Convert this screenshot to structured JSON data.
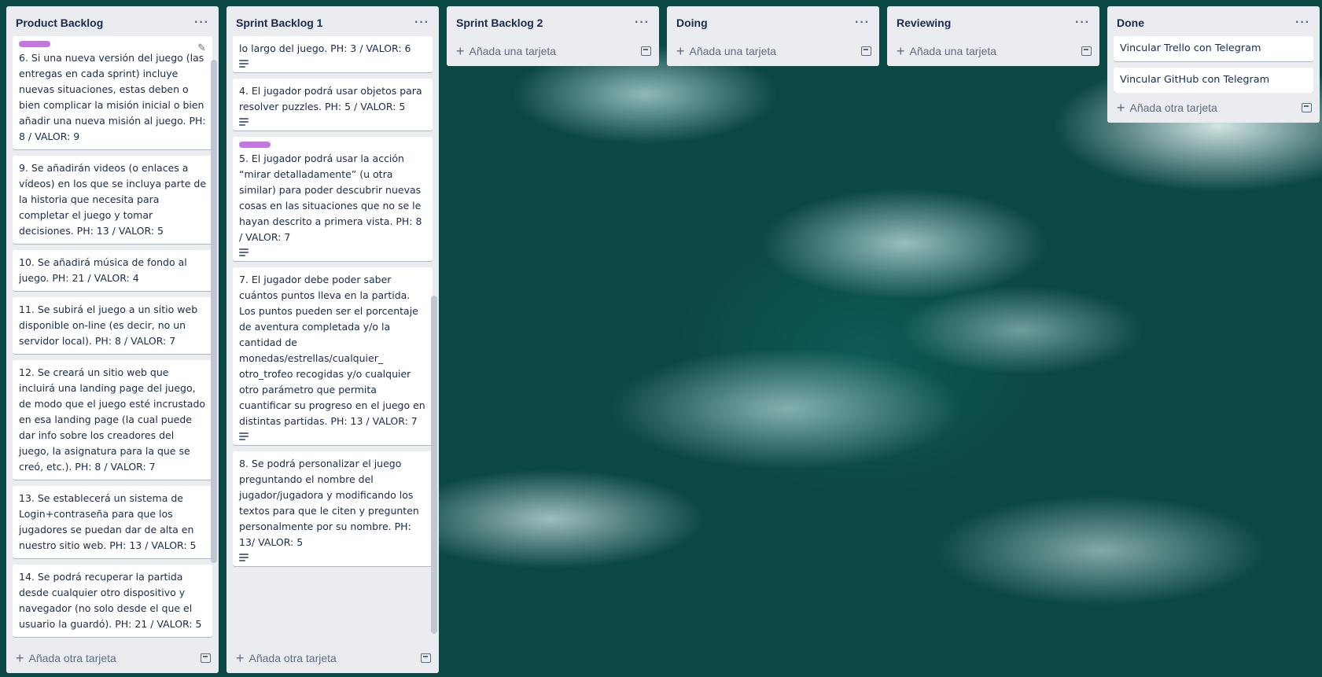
{
  "lists": [
    {
      "title": "Product Backlog",
      "menu": "···",
      "add_label": "Añada otra tarjeta",
      "cards": [
        {
          "text": "6. Si una nueva versión del juego (las entregas en cada sprint) incluye nuevas situaciones, estas deben o bien complicar la misión inicial o bien añadir una nueva misión al juego. PH: 8 / VALOR: 9",
          "label": true,
          "desc": false
        },
        {
          "text": "9. Se añadirán videos (o enlaces a vídeos) en los que se incluya parte de la historia que necesita para completar el juego y tomar decisiones. PH: 13 / VALOR: 5"
        },
        {
          "text": "10. Se añadirá música de fondo al juego. PH: 21 / VALOR: 4"
        },
        {
          "text": "11. Se subirá el juego a un sitio web disponible on-line (es decir, no un servidor local). PH: 8 / VALOR: 7"
        },
        {
          "text": "12. Se creará un sitio web que incluirá una landing page del juego, de modo que el juego esté incrustado en esa landing page (la cual puede dar info sobre los creadores del juego, la asignatura para la que se creó, etc.). PH: 8 / VALOR: 7"
        },
        {
          "text": "13. Se establecerá un sistema de Login+contraseña para que los jugadores se puedan dar de alta en nuestro sitio web. PH: 13 / VALOR: 5"
        },
        {
          "text": "14. Se podrá recuperar la partida desde cualquier otro dispositivo y navegador (no solo desde el que el usuario la guardó). PH: 21 / VALOR: 5"
        }
      ]
    },
    {
      "title": "Sprint Backlog 1",
      "menu": "···",
      "add_label": "Añada otra tarjeta",
      "cards": [
        {
          "text": "lo largo del juego. PH: 3 / VALOR: 6"
        },
        {
          "text": "4. El jugador podrá usar objetos para resolver puzzles. PH: 5 / VALOR: 5"
        },
        {
          "text": "5. El jugador podrá usar la acción “mirar detalladamente” (u otra similar) para poder descubrir nuevas cosas en las situaciones que no se le hayan descrito a primera vista. PH: 8 / VALOR: 7"
        },
        {
          "text": "7. El jugador debe poder saber cuántos puntos lleva en la partida. Los puntos pueden ser el porcentaje de aventura completada y/o la cantidad de monedas/estrellas/cualquier_ otro_trofeo recogidas y/o cualquier otro parámetro que permita cuantificar su progreso en el juego en distintas partidas. PH: 13 / VALOR: 7"
        },
        {
          "text": "8. Se podrá personalizar el juego preguntando el nombre del jugador/jugadora y modificando los textos para que le citen y pregunten personalmente por su nombre. PH: 13/ VALOR: 5"
        }
      ]
    },
    {
      "title": "Sprint Backlog 2",
      "menu": "···",
      "add_label": "Añada una tarjeta"
    },
    {
      "title": "Doing",
      "menu": "···",
      "add_label": "Añada una tarjeta"
    },
    {
      "title": "Reviewing",
      "menu": "···",
      "add_label": "Añada una tarjeta"
    },
    {
      "title": "Done",
      "menu": "···",
      "add_label": "Añada otra tarjeta",
      "cards": [
        {
          "text": "Vincular Trello con Telegram"
        },
        {
          "text": "Vincular GitHub con Telegram"
        }
      ]
    }
  ],
  "colors": {
    "list_bg": "#ebecf0",
    "label_purple": "#c377e0",
    "text": "#172b4d",
    "muted": "#5e6c84"
  },
  "icons": [
    "ellipsis-icon",
    "plus-icon",
    "template-icon",
    "description-icon",
    "pencil-icon"
  ]
}
